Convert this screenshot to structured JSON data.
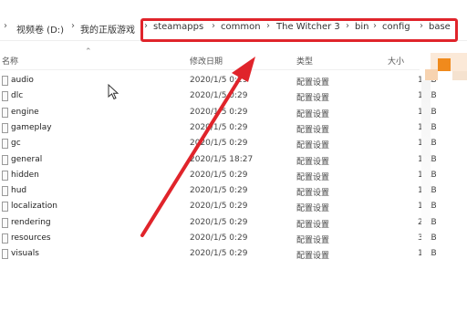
{
  "address_bar": {
    "nav_chevron": "›",
    "segments": [
      "视频卷 (D:)",
      "我的正版游戏",
      "steamapps",
      "common",
      "The Witcher 3",
      "bin",
      "config",
      "base"
    ],
    "separator": "›"
  },
  "columns": {
    "name": "名称",
    "date": "修改日期",
    "type": "类型",
    "size": "大小"
  },
  "files": [
    {
      "name": "audio",
      "date": "2020/1/5 0:29",
      "type": "配置设置",
      "size": "1 KB"
    },
    {
      "name": "dlc",
      "date": "2020/1/5 0:29",
      "type": "配置设置",
      "size": "1 KB"
    },
    {
      "name": "engine",
      "date": "2020/1/5 0:29",
      "type": "配置设置",
      "size": "1 KB"
    },
    {
      "name": "gameplay",
      "date": "2020/1/5 0:29",
      "type": "配置设置",
      "size": "1 KB"
    },
    {
      "name": "gc",
      "date": "2020/1/5 0:29",
      "type": "配置设置",
      "size": "1 KB"
    },
    {
      "name": "general",
      "date": "2020/1/5 18:27",
      "type": "配置设置",
      "size": "1 KB"
    },
    {
      "name": "hidden",
      "date": "2020/1/5 0:29",
      "type": "配置设置",
      "size": "1 KB"
    },
    {
      "name": "hud",
      "date": "2020/1/5 0:29",
      "type": "配置设置",
      "size": "1 KB"
    },
    {
      "name": "localization",
      "date": "2020/1/5 0:29",
      "type": "配置设置",
      "size": "1 KB"
    },
    {
      "name": "rendering",
      "date": "2020/1/5 0:29",
      "type": "配置设置",
      "size": "2 KB"
    },
    {
      "name": "resources",
      "date": "2020/1/5 0:29",
      "type": "配置设置",
      "size": "3 KB"
    },
    {
      "name": "visuals",
      "date": "2020/1/5 0:29",
      "type": "配置设置",
      "size": "1 KB"
    }
  ],
  "colors": {
    "annotation_red": "#e0242b",
    "pixel_orange": "#f08a1c",
    "pixel_peach": "#f7d3b0"
  },
  "icons": {
    "cursor": "mouse-pointer-icon",
    "file": "config-file-icon",
    "annotation": "red-arrow-annotation"
  }
}
